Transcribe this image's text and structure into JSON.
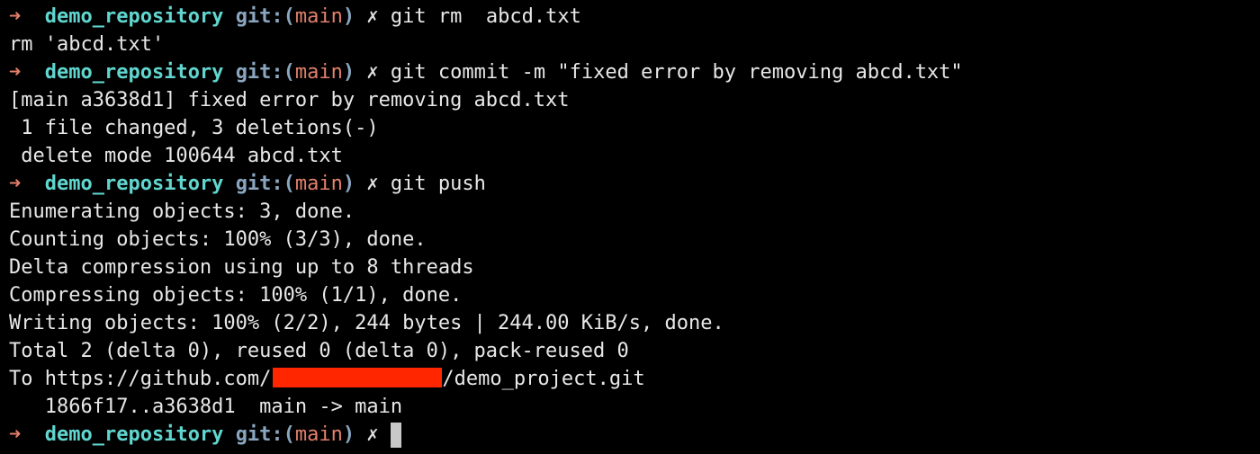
{
  "prompt": {
    "arrow": "➜",
    "directory": "demo_repository",
    "git_label": "git:",
    "paren_open": "(",
    "branch": "main",
    "paren_close": ")",
    "dirty_marker": "✗"
  },
  "lines": [
    {
      "type": "prompt",
      "command": "git rm  abcd.txt"
    },
    {
      "type": "output",
      "text": "rm 'abcd.txt'"
    },
    {
      "type": "prompt",
      "command": "git commit -m \"fixed error by removing abcd.txt\""
    },
    {
      "type": "output",
      "text": "[main a3638d1] fixed error by removing abcd.txt"
    },
    {
      "type": "output",
      "text": " 1 file changed, 3 deletions(-)"
    },
    {
      "type": "output",
      "text": " delete mode 100644 abcd.txt"
    },
    {
      "type": "prompt",
      "command": "git push"
    },
    {
      "type": "output",
      "text": "Enumerating objects: 3, done."
    },
    {
      "type": "output",
      "text": "Counting objects: 100% (3/3), done."
    },
    {
      "type": "output",
      "text": "Delta compression using up to 8 threads"
    },
    {
      "type": "output",
      "text": "Compressing objects: 100% (1/1), done."
    },
    {
      "type": "output",
      "text": "Writing objects: 100% (2/2), 244 bytes | 244.00 KiB/s, done."
    },
    {
      "type": "output",
      "text": "Total 2 (delta 0), reused 0 (delta 0), pack-reused 0"
    },
    {
      "type": "remote",
      "prefix": "To https://github.com/",
      "suffix": "/demo_project.git"
    },
    {
      "type": "output",
      "text": "   1866f17..a3638d1  main -> main"
    },
    {
      "type": "prompt",
      "command": "",
      "cursor": true
    }
  ],
  "colors": {
    "background": "#000000",
    "foreground": "#e8e8e8",
    "arrow": "#e3806c",
    "directory": "#60d6cf",
    "git_label": "#8aa6bf",
    "branch": "#e3806c",
    "redaction": "#ff2600",
    "cursor": "#c8c8c8"
  }
}
